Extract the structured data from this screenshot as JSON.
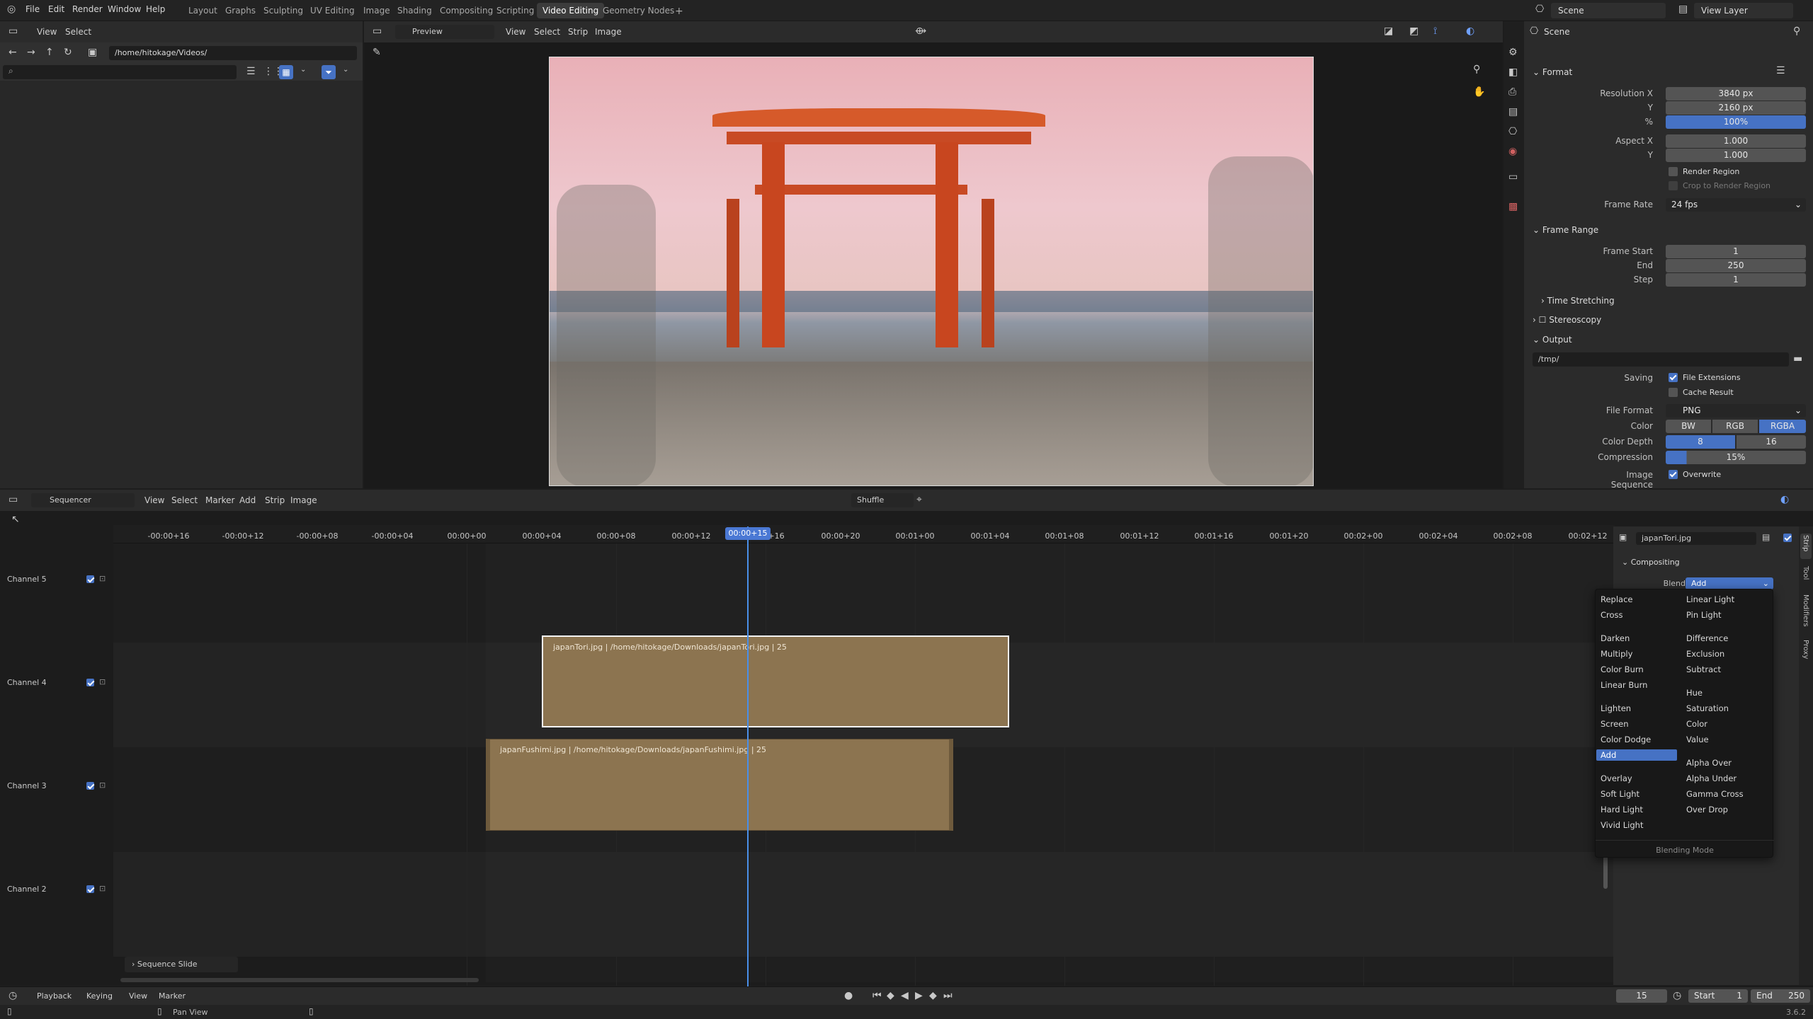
{
  "topbar": {
    "menus": [
      "File",
      "Edit",
      "Render",
      "Window",
      "Help"
    ],
    "workspaces": [
      "Layout",
      "Graphs",
      "Sculpting",
      "UV Editing",
      "Image",
      "Shading",
      "Compositing",
      "Scripting",
      "Video Editing",
      "Geometry Nodes"
    ],
    "active_workspace": "Video Editing",
    "scene": "Scene",
    "view_layer": "View Layer"
  },
  "filebrowser": {
    "menus": [
      "View",
      "Select"
    ],
    "path": "/home/hitokage/Videos/"
  },
  "preview": {
    "mode": "Preview",
    "menus": [
      "View",
      "Select",
      "Strip",
      "Image"
    ]
  },
  "properties": {
    "scene_label": "Scene",
    "format": {
      "title": "Format",
      "res_x_label": "Resolution X",
      "res_x": "3840 px",
      "res_y_label": "Y",
      "res_y": "2160 px",
      "pct_label": "%",
      "pct": "100%",
      "aspect_x_label": "Aspect X",
      "aspect_x": "1.000",
      "aspect_y_label": "Y",
      "aspect_y": "1.000",
      "render_region": "Render Region",
      "crop": "Crop to Render Region",
      "frame_rate_label": "Frame Rate",
      "frame_rate": "24 fps"
    },
    "frame_range": {
      "title": "Frame Range",
      "start_label": "Frame Start",
      "start": "1",
      "end_label": "End",
      "end": "250",
      "step_label": "Step",
      "step": "1"
    },
    "time_stretching": "Time Stretching",
    "stereoscopy": "Stereoscopy",
    "output": {
      "title": "Output",
      "path": "/tmp/",
      "saving_label": "Saving",
      "file_ext": "File Extensions",
      "cache": "Cache Result",
      "file_format_label": "File Format",
      "file_format": "PNG",
      "color_label": "Color",
      "color_opts": [
        "BW",
        "RGB",
        "RGBA"
      ],
      "depth_label": "Color Depth",
      "depth_opts": [
        "8",
        "16"
      ],
      "compression_label": "Compression",
      "compression": "15%",
      "image_seq_label": "Image Sequence",
      "overwrite": "Overwrite"
    }
  },
  "sequencer": {
    "editor": "Sequencer",
    "menus": [
      "View",
      "Select",
      "Marker",
      "Add",
      "Strip",
      "Image"
    ],
    "shuffle": "Shuffle",
    "ticks": [
      "-00:00+16",
      "-00:00+12",
      "-00:00+08",
      "-00:00+04",
      "00:00+00",
      "00:00+04",
      "00:00+08",
      "00:00+12",
      "00:00+15",
      "+16",
      "00:00+20",
      "00:01+00",
      "00:01+04",
      "00:01+08",
      "00:01+12",
      "00:01+16",
      "00:01+20",
      "00:02+00",
      "00:02+04",
      "00:02+08",
      "00:02+12"
    ],
    "channels": [
      "Channel 5",
      "Channel 4",
      "Channel 3",
      "Channel 2"
    ],
    "strip_tori": "japanTori.jpg | /home/hitokage/Downloads/japanTori.jpg | 25",
    "strip_fushimi": "japanFushimi.jpg | /home/hitokage/Downloads/japanFushimi.jpg | 25",
    "sequence_slide": "Sequence Slide"
  },
  "sidebar": {
    "strip_name": "japanTori.jpg",
    "compositing": "Compositing",
    "blend_label": "Blend",
    "blend_value": "Add",
    "tabs": [
      "Strip",
      "Tool",
      "Modifiers",
      "Proxy"
    ]
  },
  "blend_menu": {
    "col1": [
      "Replace",
      "Cross",
      "Darken",
      "Multiply",
      "Color Burn",
      "Linear Burn",
      "Lighten",
      "Screen",
      "Color Dodge",
      "Add",
      "Overlay",
      "Soft Light",
      "Hard Light",
      "Vivid Light"
    ],
    "col2": [
      "Linear Light",
      "Pin Light",
      "Difference",
      "Exclusion",
      "Subtract",
      "Hue",
      "Saturation",
      "Color",
      "Value",
      "Alpha Over",
      "Alpha Under",
      "Gamma Cross",
      "Over Drop"
    ],
    "footer": "Blending Mode",
    "selected": "Add"
  },
  "timeline": {
    "menus": [
      "Playback",
      "Keying",
      "View",
      "Marker"
    ],
    "frame": "15",
    "start_label": "Start",
    "start": "1",
    "end_label": "End",
    "end": "250"
  },
  "statusbar": {
    "pan": "Pan View",
    "version": "3.6.2"
  }
}
